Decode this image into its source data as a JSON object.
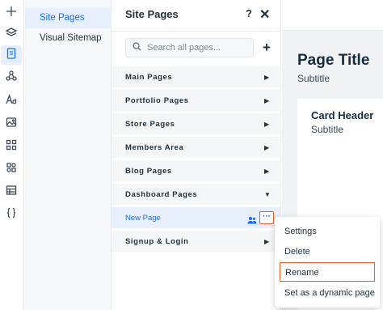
{
  "rail": {
    "items": [
      {
        "icon": "plus-icon"
      },
      {
        "icon": "layers-icon"
      },
      {
        "icon": "pages-icon",
        "active": true
      },
      {
        "icon": "design-icon"
      },
      {
        "icon": "text-theme-icon"
      },
      {
        "icon": "media-icon"
      },
      {
        "icon": "apps-icon"
      },
      {
        "icon": "business-apps-icon"
      },
      {
        "icon": "cms-table-icon"
      },
      {
        "icon": "code-braces-icon"
      }
    ]
  },
  "submenu": {
    "items": [
      {
        "label": "Site Pages",
        "active": true
      },
      {
        "label": "Visual Sitemap",
        "active": false
      }
    ]
  },
  "panel": {
    "title": "Site Pages",
    "help": "?",
    "close": "✕",
    "search_placeholder": "Search all pages...",
    "add": "+",
    "rows": [
      {
        "label": "Main Pages",
        "arrow": "▶"
      },
      {
        "label": "Portfolio Pages",
        "arrow": "▶"
      },
      {
        "label": "Store Pages",
        "arrow": "▶"
      },
      {
        "label": "Members Area",
        "arrow": "▶"
      },
      {
        "label": "Blog Pages",
        "arrow": "▶"
      },
      {
        "label": "Dashboard Pages",
        "arrow": "▼"
      },
      {
        "label": "New Page",
        "more": "···"
      },
      {
        "label": "Signup & Login",
        "arrow": "▶"
      }
    ]
  },
  "canvas": {
    "page_title": "Page Title",
    "page_subtitle": "Subtitle",
    "card_header": "Card Header",
    "card_subtitle": "Subtitle"
  },
  "context_menu": {
    "items": [
      {
        "label": "Settings"
      },
      {
        "label": "Delete"
      },
      {
        "label": "Rename",
        "highlighted": true
      },
      {
        "label": "Set as a dynamic page"
      }
    ]
  },
  "colors": {
    "accent": "#116dff",
    "highlight_outline": "#e85d2a"
  }
}
